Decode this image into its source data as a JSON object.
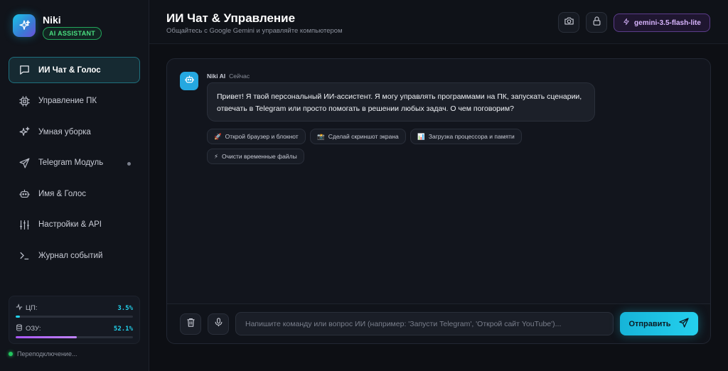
{
  "brand": {
    "name": "Niki",
    "badge": "AI ASSISTANT"
  },
  "sidebar": {
    "items": [
      {
        "label": "ИИ Чат & Голос",
        "icon": "chat-bubble-icon",
        "active": true
      },
      {
        "label": "Управление ПК",
        "icon": "cpu-chip-icon"
      },
      {
        "label": "Умная уборка",
        "icon": "sparkles-icon"
      },
      {
        "label": "Telegram Модуль",
        "icon": "paper-plane-icon",
        "status_dot": true
      },
      {
        "label": "Имя & Голос",
        "icon": "robot-icon"
      },
      {
        "label": "Настройки & API",
        "icon": "sliders-icon"
      },
      {
        "label": "Журнал событий",
        "icon": "terminal-icon"
      }
    ],
    "stats": {
      "cpu": {
        "label": "ЦП:",
        "value": "3.5%",
        "percent": 3.5
      },
      "ram": {
        "label": "ОЗУ:",
        "value": "52.1%",
        "percent": 52.1
      }
    },
    "connection": "Переподключение..."
  },
  "header": {
    "title": "ИИ Чат & Управление",
    "subtitle": "Общайтесь с Google Gemini и управляйте компьютером",
    "model": "gemini-3.5-flash-lite"
  },
  "chat": {
    "messages": [
      {
        "author": "Niki AI",
        "time": "Сейчас",
        "text": "Привет! Я твой персональный ИИ-ассистент. Я могу управлять программами на ПК, запускать сценарии, отвечать в Telegram или просто помогать в решении любых задач. О чем поговорим?"
      }
    ],
    "suggestions": [
      {
        "emoji": "🚀",
        "label": "Открой браузер и блокнот"
      },
      {
        "emoji": "📸",
        "label": "Сделай скриншот экрана"
      },
      {
        "emoji": "📊",
        "label": "Загрузка процессора и памяти"
      },
      {
        "emoji": "⚡",
        "label": "Очисти временные файлы"
      }
    ],
    "input_placeholder": "Напишите команду или вопрос ИИ (например: 'Запусти Telegram', 'Открой сайт YouTube')...",
    "send_label": "Отправить"
  },
  "colors": {
    "accent": "#22d3ee",
    "model_accent": "#d8b4fe",
    "status_ok": "#22c55e",
    "badge_green": "#4ade80"
  }
}
